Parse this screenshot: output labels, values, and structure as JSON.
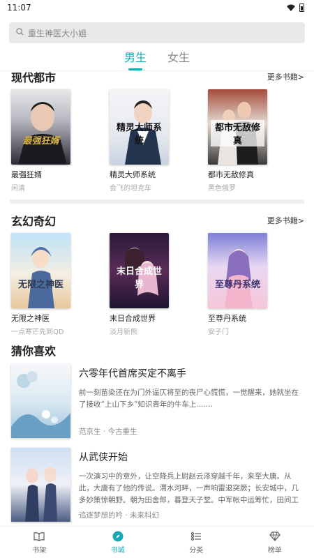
{
  "status": {
    "time": "11:07"
  },
  "search": {
    "placeholder": "重生神医大小姐"
  },
  "tabs": [
    {
      "label": "男生",
      "active": true
    },
    {
      "label": "女生",
      "active": false
    }
  ],
  "sections": [
    {
      "title": "现代都市",
      "more": "更多书籍>",
      "books": [
        {
          "title": "最强狂婿",
          "author": "闲清",
          "cover_text": "最强狂婿"
        },
        {
          "title": "精灵大师系统",
          "author": "会飞的坦克车",
          "cover_text": "精灵大师系统"
        },
        {
          "title": "都市无敌修真",
          "author": "黑色俄罗",
          "cover_text": "都市无敌修真"
        }
      ]
    },
    {
      "title": "玄幻奇幻",
      "more": "更多书籍>",
      "books": [
        {
          "title": "无限之神医",
          "author": "一点寒芒先到QD",
          "cover_text": "无限之神医"
        },
        {
          "title": "末日合成世界",
          "author": "淡月新熊",
          "cover_text": "末日合成世界"
        },
        {
          "title": "至尊丹系统",
          "author": "安子门",
          "cover_text": "至尊丹系统"
        }
      ]
    }
  ],
  "recommend": {
    "title": "猜你喜欢",
    "items": [
      {
        "title": "六零年代首席买定不离手",
        "desc": "前一刻苗染还在为门外逼仄将至的丧尸心慌慌，一觉醒来，她就坐在了接收“上山下乡”知识青年的牛车上.......",
        "meta": "范京生 · 今古重生"
      },
      {
        "title": "从武侠开始",
        "desc": "一次演习中的意外，让空降兵上尉赵云泽穿越千年，来至大唐。从此，大唐有了他的传说。渭水河畔，一声响雷退突厥；长安城中，几多妙策惊朝野。朝为田舍郎，暮登天子堂。中军帐中运筹忙，田间工坊汗水淌；诗词",
        "meta": "追逐梦想的吟 · 未来科幻"
      }
    ]
  },
  "bottom_nav": [
    {
      "label": "书架",
      "icon": "book-open-icon",
      "active": false
    },
    {
      "label": "书城",
      "icon": "compass-icon",
      "active": true
    },
    {
      "label": "分类",
      "icon": "category-list-icon",
      "active": false
    },
    {
      "label": "榜单",
      "icon": "diamond-icon",
      "active": false
    }
  ],
  "colors": {
    "accent": "#18a9b7"
  }
}
